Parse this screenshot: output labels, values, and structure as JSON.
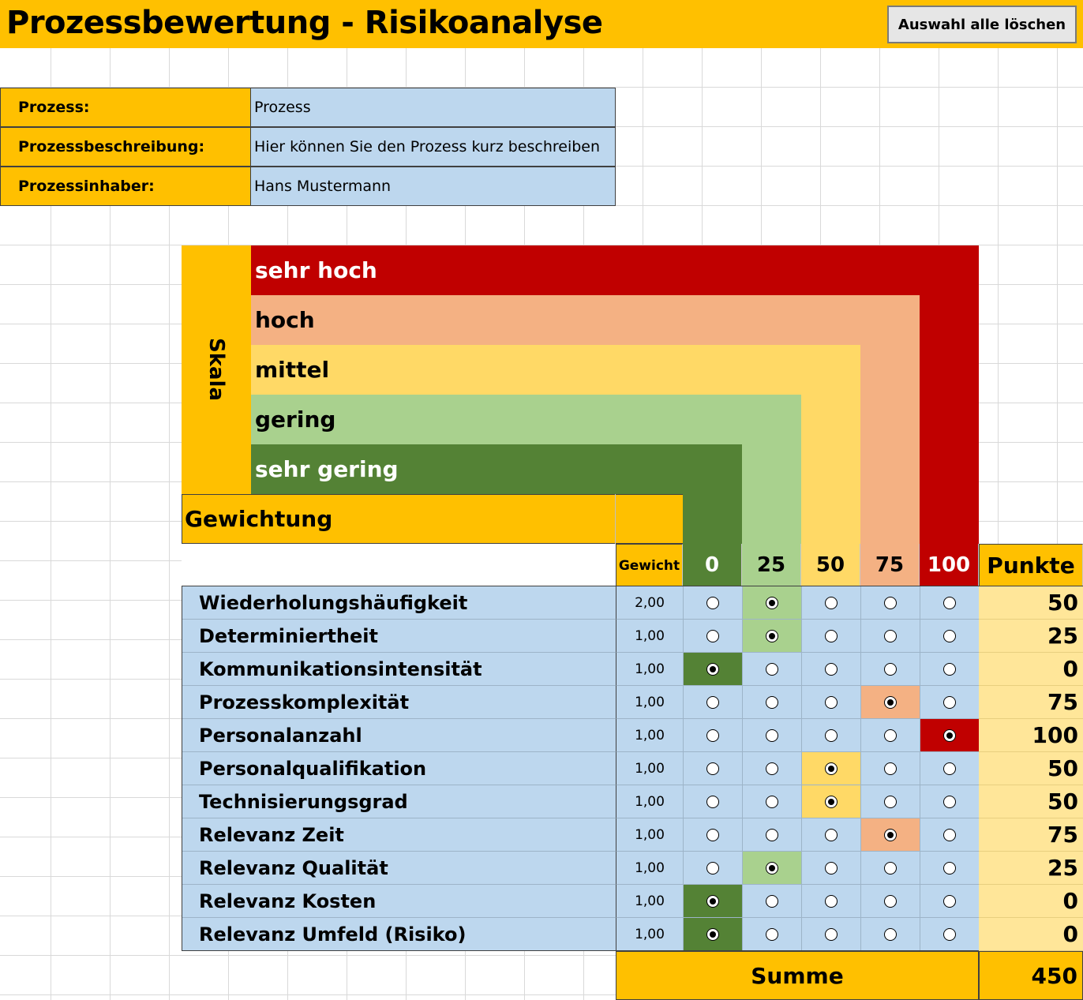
{
  "app": {
    "title": "Prozessbewertung - Risikoanalyse",
    "clear_button": "Auswahl alle löschen"
  },
  "info": [
    {
      "label": "Prozess:",
      "value": "Prozess"
    },
    {
      "label": "Prozessbeschreibung:",
      "value": "Hier können Sie den Prozess kurz beschreiben"
    },
    {
      "label": "Prozessinhaber:",
      "value": "Hans Mustermann"
    }
  ],
  "scale": {
    "title": "Skala",
    "bands": [
      {
        "label": "sehr hoch",
        "color": "#c00000",
        "text_color": "#ffffff"
      },
      {
        "label": "hoch",
        "color": "#f4b183",
        "text_color": "#000000"
      },
      {
        "label": "mittel",
        "color": "#ffd966",
        "text_color": "#000000"
      },
      {
        "label": "gering",
        "color": "#a9d18e",
        "text_color": "#000000"
      },
      {
        "label": "sehr gering",
        "color": "#548235",
        "text_color": "#ffffff"
      }
    ]
  },
  "weighting_label": "Gewichtung",
  "header": {
    "weight": "Gewicht",
    "levels": [
      "0",
      "25",
      "50",
      "75",
      "100"
    ],
    "level_colors": [
      "#548235",
      "#a9d18e",
      "#ffd966",
      "#f4b183",
      "#c00000"
    ],
    "level_text_colors": [
      "#ffffff",
      "#000000",
      "#000000",
      "#000000",
      "#ffffff"
    ],
    "points": "Punkte"
  },
  "rows": [
    {
      "label": "Wiederholungshäufigkeit",
      "weight": "2,00",
      "selected": 1,
      "points": "50"
    },
    {
      "label": "Determiniertheit",
      "weight": "1,00",
      "selected": 1,
      "points": "25"
    },
    {
      "label": "Kommunikationsintensität",
      "weight": "1,00",
      "selected": 0,
      "points": "0"
    },
    {
      "label": "Prozesskomplexität",
      "weight": "1,00",
      "selected": 3,
      "points": "75"
    },
    {
      "label": "Personalanzahl",
      "weight": "1,00",
      "selected": 4,
      "points": "100"
    },
    {
      "label": "Personalqualifikation",
      "weight": "1,00",
      "selected": 2,
      "points": "50"
    },
    {
      "label": "Technisierungsgrad",
      "weight": "1,00",
      "selected": 2,
      "points": "50"
    },
    {
      "label": "Relevanz Zeit",
      "weight": "1,00",
      "selected": 3,
      "points": "75"
    },
    {
      "label": "Relevanz Qualität",
      "weight": "1,00",
      "selected": 1,
      "points": "25"
    },
    {
      "label": "Relevanz Kosten",
      "weight": "1,00",
      "selected": 0,
      "points": "0"
    },
    {
      "label": "Relevanz Umfeld (Risiko)",
      "weight": "1,00",
      "selected": 0,
      "points": "0"
    }
  ],
  "sum": {
    "label": "Summe",
    "value": "450"
  }
}
